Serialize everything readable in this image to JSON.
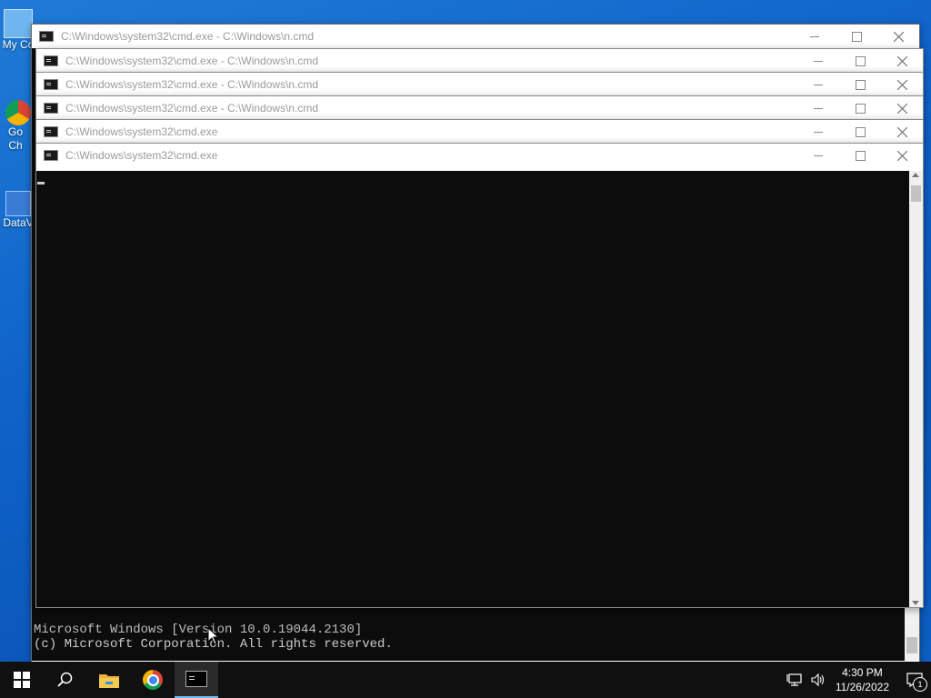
{
  "desktop": {
    "icons": [
      {
        "label": "My Co"
      },
      {
        "label": "Go Ch"
      },
      {
        "label": "DataV"
      }
    ]
  },
  "windows": [
    {
      "title": "C:\\Windows\\system32\\cmd.exe - C:\\Windows\\n.cmd"
    },
    {
      "title": "C:\\Windows\\system32\\cmd.exe - C:\\Windows\\n.cmd"
    },
    {
      "title": "C:\\Windows\\system32\\cmd.exe - C:\\Windows\\n.cmd"
    },
    {
      "title": "C:\\Windows\\system32\\cmd.exe - C:\\Windows\\n.cmd"
    },
    {
      "title": "C:\\Windows\\system32\\cmd.exe"
    },
    {
      "title": "C:\\Windows\\system32\\cmd.exe"
    }
  ],
  "back_console": {
    "line1": "Microsoft Windows [Version 10.0.19044.2130]",
    "line2": "(c) Microsoft Corporation. All rights reserved."
  },
  "taskbar": {
    "time": "4:30 PM",
    "date": "11/26/2022",
    "notification_count": "1"
  },
  "icons": [
    "windows-start-icon",
    "search-icon",
    "file-explorer-icon",
    "chrome-icon",
    "cmd-icon",
    "network-icon",
    "volume-icon",
    "notification-icon"
  ]
}
